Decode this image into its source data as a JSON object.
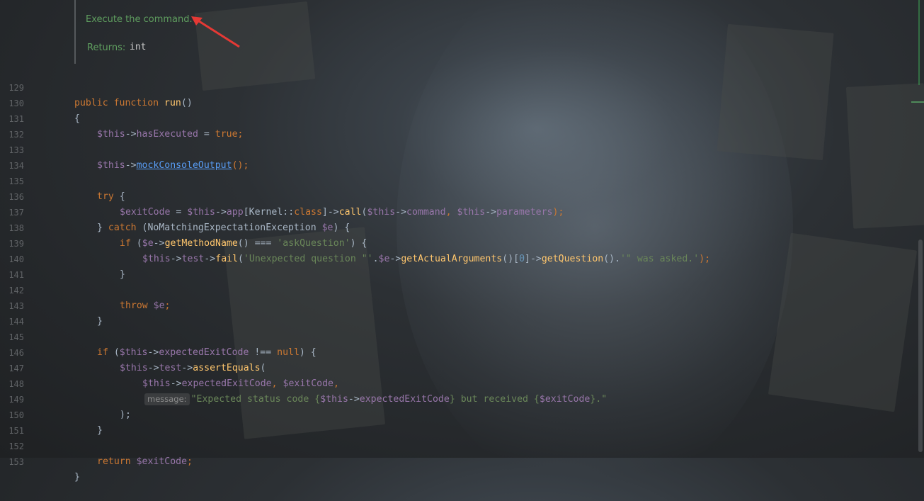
{
  "doc": {
    "description": "Execute the command.",
    "returns_label": "Returns:",
    "returns_type": "int"
  },
  "lines": [
    {
      "n": "129"
    },
    {
      "n": "130"
    },
    {
      "n": "131"
    },
    {
      "n": "132"
    },
    {
      "n": "133"
    },
    {
      "n": "134"
    },
    {
      "n": "135"
    },
    {
      "n": "136"
    },
    {
      "n": "137"
    },
    {
      "n": "138"
    },
    {
      "n": "139"
    },
    {
      "n": "140"
    },
    {
      "n": "141"
    },
    {
      "n": "142"
    },
    {
      "n": "143"
    },
    {
      "n": "144"
    },
    {
      "n": "145"
    },
    {
      "n": "146"
    },
    {
      "n": "147"
    },
    {
      "n": "148"
    },
    {
      "n": "149"
    },
    {
      "n": "150"
    },
    {
      "n": "151"
    },
    {
      "n": "152"
    },
    {
      "n": "153"
    }
  ],
  "code": {
    "l129": {
      "kw1": "public function ",
      "fn": "run",
      "rest": "()"
    },
    "l130": {
      "text": "{"
    },
    "l131": {
      "var": "$this",
      "arrow": "->",
      "prop": "hasExecuted",
      "eq": " = ",
      "val": "true",
      "semi": ";"
    },
    "l133": {
      "var": "$this",
      "arrow": "->",
      "method": "mockConsoleOutput",
      "rest": "();"
    },
    "l135": {
      "kw": "try",
      "rest": " {"
    },
    "l136": {
      "v1": "$exitCode",
      "eq": " = ",
      "v2": "$this",
      "a1": "->",
      "p1": "app",
      "b1": "[Kernel::",
      "cls": "class",
      "b2": "]->",
      "fn": "call",
      "o": "(",
      "v3": "$this",
      "a2": "->",
      "p2": "command",
      "c": ", ",
      "v4": "$this",
      "a3": "->",
      "p3": "parameters",
      "end": ");"
    },
    "l137": {
      "b": "} ",
      "kw": "catch",
      "mid": " (NoMatchingExpectationException ",
      "var": "$e",
      "end": ") {"
    },
    "l138": {
      "kw": "if",
      "o": " (",
      "var": "$e",
      "a": "->",
      "fn": "getMethodName",
      "mid": "() === ",
      "str": "'askQuestion'",
      "end": ") {"
    },
    "l139": {
      "v1": "$this",
      "a1": "->",
      "p1": "test",
      "a2": "->",
      "fn": "fail",
      "o": "(",
      "s1": "'Unexpected question \"'",
      "dot1": ".",
      "v2": "$e",
      "a3": "->",
      "fn2": "getActualArguments",
      "b1": "()[",
      "num": "0",
      "b2": "]->",
      "fn3": "getQuestion",
      "b3": "().",
      "s2": "'\" was asked.'",
      "end": ");"
    },
    "l140": {
      "text": "}"
    },
    "l142": {
      "kw": "throw ",
      "var": "$e",
      "end": ";"
    },
    "l143": {
      "text": "}"
    },
    "l145": {
      "kw": "if",
      "o": " (",
      "v": "$this",
      "a": "->",
      "p": "expectedExitCode",
      "mid": " !== ",
      "nul": "null",
      "end": ") {"
    },
    "l146": {
      "v": "$this",
      "a1": "->",
      "p": "test",
      "a2": "->",
      "fn": "assertEquals",
      "end": "("
    },
    "l147": {
      "v1": "$this",
      "a": "->",
      "p": "expectedExitCode",
      "c": ", ",
      "v2": "$exitCode",
      "end": ","
    },
    "l148": {
      "hint": "message:",
      "s1": "\"Expected status code {",
      "v1": "$this",
      "a": "->",
      "p": "expectedExitCode",
      "s2": "} but received {",
      "v2": "$exitCode",
      "s3": "}.\""
    },
    "l149": {
      "text": ");"
    },
    "l150": {
      "text": "}"
    },
    "l152": {
      "kw": "return ",
      "var": "$exitCode",
      "end": ";"
    },
    "l153": {
      "text": "}"
    }
  }
}
